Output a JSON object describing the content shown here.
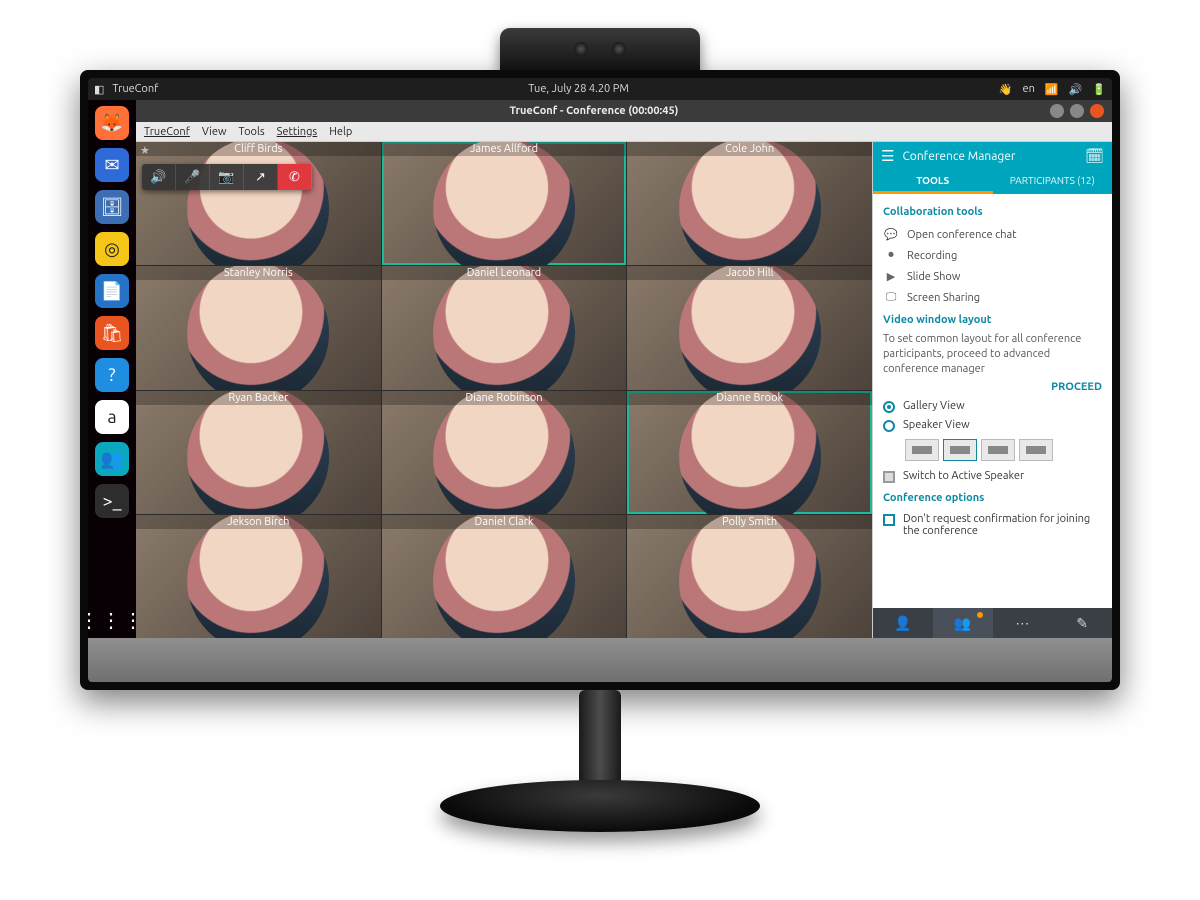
{
  "os": {
    "topbar_app": "TrueConf",
    "clock": "Tue, July 28 4.20 PM",
    "lang": "en",
    "window_title": "TrueConf - Conference (00:00:45)",
    "dock": [
      {
        "name": "firefox",
        "bg": "#ff7139",
        "glyph": "🦊"
      },
      {
        "name": "thunderbird",
        "bg": "#2e6bd9",
        "glyph": "✉"
      },
      {
        "name": "files",
        "bg": "#3c6eb4",
        "glyph": "🗄"
      },
      {
        "name": "rhythmbox",
        "bg": "#f5c518",
        "glyph": "◎"
      },
      {
        "name": "writer",
        "bg": "#2673c6",
        "glyph": "📄"
      },
      {
        "name": "software",
        "bg": "#e95420",
        "glyph": "🛍"
      },
      {
        "name": "help",
        "bg": "#1f8de0",
        "glyph": "?"
      },
      {
        "name": "amazon",
        "bg": "#ffffff",
        "glyph": "a"
      },
      {
        "name": "trueconf",
        "bg": "#0aa7bf",
        "glyph": "👥"
      },
      {
        "name": "terminal",
        "bg": "#2d2d2d",
        "glyph": ">_"
      }
    ]
  },
  "menubar": [
    "TrueConf",
    "View",
    "Tools",
    "Settings",
    "Help"
  ],
  "call_toolbar": [
    {
      "name": "speaker",
      "glyph": "🔊"
    },
    {
      "name": "mic",
      "glyph": "🎤"
    },
    {
      "name": "camera",
      "glyph": "📷"
    },
    {
      "name": "share",
      "glyph": "↗"
    },
    {
      "name": "hangup",
      "glyph": "✆",
      "red": true
    }
  ],
  "participants": [
    {
      "name": "Cliff Birds",
      "star": true
    },
    {
      "name": "James Allford",
      "highlight": "both"
    },
    {
      "name": "Cole John"
    },
    {
      "name": "Stanley Norris"
    },
    {
      "name": "Daniel Leonard"
    },
    {
      "name": "Jacob Hill"
    },
    {
      "name": "Ryan Backer"
    },
    {
      "name": "Diane Robinson"
    },
    {
      "name": "Dianne Brook",
      "highlight": "both"
    },
    {
      "name": "Jekson Birch"
    },
    {
      "name": "Daniel Clark"
    },
    {
      "name": "Polly Smith"
    }
  ],
  "sidebar": {
    "title": "Conference Manager",
    "tabs": {
      "tools": "TOOLS",
      "participants_label": "PARTICIPANTS",
      "participants_count": 12
    },
    "section_collab": "Collaboration tools",
    "tools": [
      {
        "id": "chat",
        "label": "Open conference chat",
        "glyph": "💬"
      },
      {
        "id": "record",
        "label": "Recording",
        "glyph": "⏺"
      },
      {
        "id": "slides",
        "label": "Slide Show",
        "glyph": "▶"
      },
      {
        "id": "share",
        "label": "Screen Sharing",
        "glyph": "🖵"
      }
    ],
    "section_layout": "Video window layout",
    "layout_help": "To set common layout for all conference participants, proceed to advanced conference manager",
    "proceed": "PROCEED",
    "layout_radios": {
      "gallery": "Gallery View",
      "speaker": "Speaker View",
      "selected": "gallery"
    },
    "switch_active": "Switch to Active Speaker",
    "section_options": "Conference options",
    "option_noconfirm": "Don't request confirmation for joining the conference",
    "bottom_icons": [
      {
        "name": "contacts",
        "glyph": "👤"
      },
      {
        "name": "manager",
        "glyph": "👥",
        "active": true,
        "dot": true
      },
      {
        "name": "chat",
        "glyph": "⋯"
      },
      {
        "name": "tools",
        "glyph": "✎"
      }
    ]
  }
}
